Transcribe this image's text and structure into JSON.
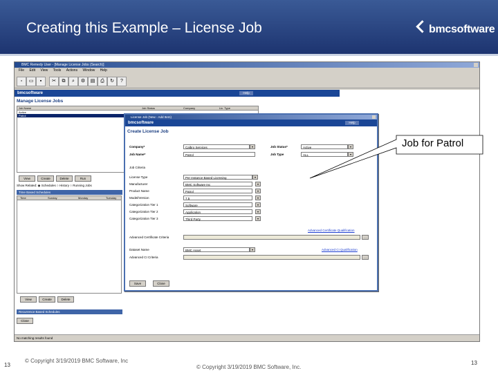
{
  "slide": {
    "title": "Creating this Example – License Job",
    "logo_text": "bmcsoftware",
    "callout": "Job for Patrol",
    "footer_left_number": "13",
    "footer_left_copyright": "© Copyright 3/19/2019 BMC Software, Inc",
    "footer_center_copyright": "© Copyright 3/19/2019 BMC Software, Inc.",
    "footer_right_number": "13"
  },
  "app": {
    "window_title": "BMC Remedy User - [Manage License Jobs (Search)]",
    "menu": [
      "File",
      "Edit",
      "View",
      "Tools",
      "Actions",
      "Window",
      "Help"
    ],
    "toolbar_icons": [
      "new-icon",
      "open-icon",
      "save-icon",
      "cut-icon",
      "copy-icon",
      "search-icon",
      "gear-icon",
      "report-icon",
      "print-icon",
      "refresh-icon",
      "help-icon"
    ],
    "brand": "bmcsoftware",
    "help_label": "Help",
    "panel_title": "Manage License Jobs",
    "list_headers": [
      "Job Name",
      "Job Status",
      "Company",
      "Lic. Type"
    ],
    "list_rows": [
      {
        "name": "Active",
        "selected": false
      },
      {
        "name": "Patrol",
        "selected": true
      }
    ],
    "buttons_row1": [
      "View",
      "Create",
      "Delete",
      "Run"
    ],
    "show_related_label": "Show Related:",
    "radio_options": [
      {
        "label": "Schedules",
        "checked": true
      },
      {
        "label": "History",
        "checked": false
      },
      {
        "label": "Running Jobs",
        "checked": false
      }
    ],
    "time_section": "Time Based Schedules",
    "time_headers": [
      "Time",
      "Sunday",
      "Monday",
      "Tuesday"
    ],
    "buttons_row2": [
      "View",
      "Create",
      "Delete"
    ],
    "recurrence_section": "Recurrence Based Schedules",
    "close_label": "Close",
    "status_text": "No matching results found"
  },
  "dialog": {
    "title": "License Job (New - Add Item)",
    "brand": "bmcsoftware",
    "help_label": "Help",
    "heading": "Create License Job",
    "company_label": "Company*",
    "company_value": "Calbro Services",
    "job_status_label": "Job Status*",
    "job_status_value": "Active",
    "job_name_label": "Job Name*",
    "job_name_value": "Patrol",
    "job_type_label": "Job Type",
    "job_type_value": "ALL",
    "criteria_label": "Job Criteria",
    "fields": [
      {
        "label": "License Type",
        "value": "Per Instance Based Licensing"
      },
      {
        "label": "Manufacturer",
        "value": "BMC Software Inc"
      },
      {
        "label": "Product Name",
        "value": "Patrol"
      },
      {
        "label": "Model/Version",
        "value": "7.5"
      },
      {
        "label": "Categorization Tier 1",
        "value": "Software"
      },
      {
        "label": "Categorization Tier 2",
        "value": "Application"
      },
      {
        "label": "Categorization Tier 3",
        "value": "Third Party"
      }
    ],
    "adv_cert_link": "Advanced Certificate Qualification",
    "adv_cert_label": "Advanced Certificate Criteria",
    "dataset_label": "Dataset Name",
    "dataset_value": "BMC Asset",
    "adv_ci_link": "Advanced CI Qualification",
    "adv_ci_label": "Advanced CI Criteria",
    "save_label": "Save",
    "close_label": "Close"
  }
}
